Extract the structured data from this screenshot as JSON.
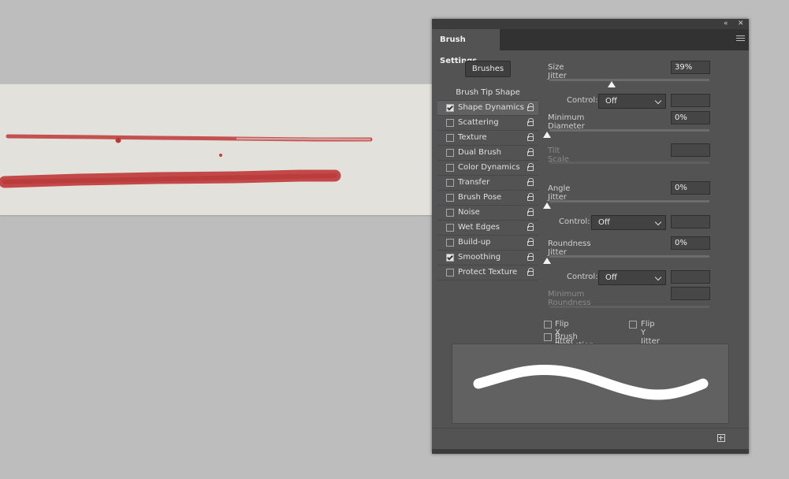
{
  "panel": {
    "tab_title": "Brush Settings",
    "collapse_icon": "double-chevron-left-icon",
    "close_icon": "close-icon",
    "menu_icon": "hamburger-menu-icon",
    "brushes_button": "Brushes",
    "list": {
      "header": "Brush Tip Shape",
      "items": [
        {
          "label": "Shape Dynamics",
          "checked": true,
          "selected": true
        },
        {
          "label": "Scattering",
          "checked": false
        },
        {
          "label": "Texture",
          "checked": false
        },
        {
          "label": "Dual Brush",
          "checked": false
        },
        {
          "label": "Color Dynamics",
          "checked": false
        },
        {
          "label": "Transfer",
          "checked": false
        },
        {
          "label": "Brush Pose",
          "checked": false
        },
        {
          "label": "Noise",
          "checked": false
        },
        {
          "label": "Wet Edges",
          "checked": false
        },
        {
          "label": "Build-up",
          "checked": false
        },
        {
          "label": "Smoothing",
          "checked": true
        },
        {
          "label": "Protect Texture",
          "checked": false
        }
      ]
    },
    "settings": {
      "size_jitter": {
        "label": "Size Jitter",
        "value": "39%",
        "level": 0.39
      },
      "size_control": {
        "label": "Control:",
        "value": "Off"
      },
      "min_diameter": {
        "label": "Minimum Diameter",
        "value": "0%",
        "level": 0
      },
      "tilt_scale": {
        "label": "Tilt Scale"
      },
      "angle_jitter": {
        "label": "Angle Jitter",
        "value": "0%",
        "level": 0
      },
      "angle_control": {
        "label": "Control:",
        "value": "Off"
      },
      "roundness_jitter": {
        "label": "Roundness Jitter",
        "value": "0%",
        "level": 0
      },
      "roundness_control": {
        "label": "Control:",
        "value": "Off"
      },
      "min_roundness": {
        "label": "Minimum Roundness"
      },
      "flip_x": {
        "label": "Flip X Jitter",
        "checked": false
      },
      "flip_y": {
        "label": "Flip Y Jitter",
        "checked": false
      },
      "brush_projection": {
        "label": "Brush Projection",
        "checked": false
      }
    },
    "new_brush_icon": "new-brush-plus-icon"
  },
  "colors": {
    "canvas": "#e3e1dc",
    "stroke": "#c0403f",
    "panel_bg": "#535353"
  }
}
